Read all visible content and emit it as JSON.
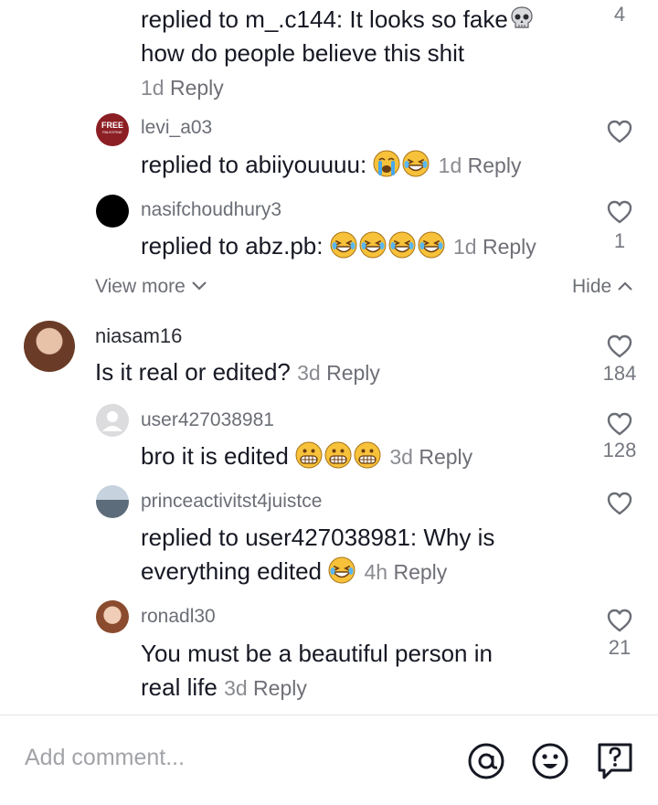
{
  "comments": [
    {
      "reply_prefix": "replied to ",
      "mention": "m_.c144",
      "text": ": It looks so fake",
      "text2": "how do people believe this shit",
      "time": "1d",
      "reply_label": "Reply",
      "likes": "4"
    },
    {
      "avatar_text": "FREE",
      "avatar_subtext": "PALESTINE",
      "username": "levi_a03",
      "reply_prefix": "replied to ",
      "mention": "abiiyouuuu",
      "text": ":",
      "time": "1d",
      "reply_label": "Reply",
      "likes": ""
    },
    {
      "username": "nasifchoudhury3",
      "reply_prefix": "replied to ",
      "mention": "abz.pb",
      "text": ":",
      "time": "1d",
      "reply_label": "Reply",
      "likes": "1"
    },
    {
      "username": "niasam16",
      "text": "Is it real or edited?",
      "time": "3d",
      "reply_label": "Reply",
      "likes": "184"
    },
    {
      "username": "user427038981",
      "text": "bro it is edited",
      "time": "3d",
      "reply_label": "Reply",
      "likes": "128"
    },
    {
      "username": "princeactivitst4juistce",
      "reply_prefix": "replied to ",
      "mention": "user427038981",
      "text": ": Why is",
      "text2": "everything edited",
      "time": "4h",
      "reply_label": "Reply",
      "likes": ""
    },
    {
      "username": "ronadl30",
      "text": "You must be a beautiful person in",
      "text2": "real life",
      "time": "3d",
      "reply_label": "Reply",
      "likes": "21"
    }
  ],
  "view_more_label": "View more",
  "hide_label": "Hide",
  "input": {
    "placeholder": "Add comment..."
  },
  "icons": [
    "skull-emoji",
    "crying-emoji",
    "laughing-emoji",
    "grimacing-emoji",
    "heart-icon",
    "mention-icon",
    "emoji-icon",
    "question-icon"
  ],
  "colors": {
    "text": "#161823",
    "secondary": "#8a8b91",
    "username": "#6b6e76"
  }
}
